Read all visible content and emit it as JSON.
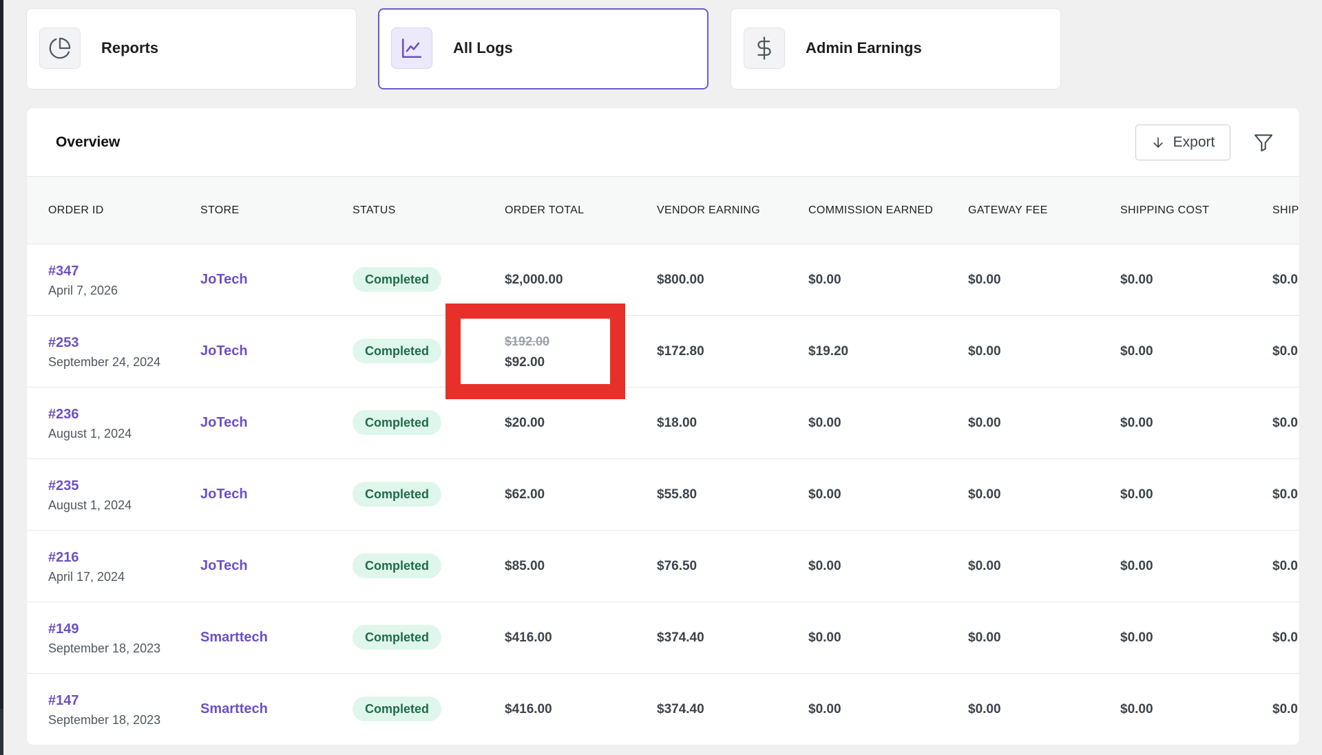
{
  "tabs": [
    {
      "label": "Reports",
      "icon": "pie-chart-icon"
    },
    {
      "label": "All Logs",
      "icon": "line-chart-icon"
    },
    {
      "label": "Admin Earnings",
      "icon": "dollar-icon"
    }
  ],
  "panel": {
    "title": "Overview",
    "export_label": "Export"
  },
  "columns": [
    "Order ID",
    "Store",
    "Status",
    "Order Total",
    "Vendor Earning",
    "Commission Earned",
    "Gateway Fee",
    "Shipping Cost",
    "Ship"
  ],
  "rows": [
    {
      "id": "#347",
      "date": "April 7, 2026",
      "store": "JoTech",
      "status": "Completed",
      "total": "$2,000.00",
      "total_old": "",
      "vendor": "$800.00",
      "commission": "$0.00",
      "gateway": "$0.00",
      "shipping": "$0.00",
      "ship2": "$0.0"
    },
    {
      "id": "#253",
      "date": "September 24, 2024",
      "store": "JoTech",
      "status": "Completed",
      "total": "$92.00",
      "total_old": "$192.00",
      "vendor": "$172.80",
      "commission": "$19.20",
      "gateway": "$0.00",
      "shipping": "$0.00",
      "ship2": "$0.0"
    },
    {
      "id": "#236",
      "date": "August 1, 2024",
      "store": "JoTech",
      "status": "Completed",
      "total": "$20.00",
      "total_old": "",
      "vendor": "$18.00",
      "commission": "$0.00",
      "gateway": "$0.00",
      "shipping": "$0.00",
      "ship2": "$0.0"
    },
    {
      "id": "#235",
      "date": "August 1, 2024",
      "store": "JoTech",
      "status": "Completed",
      "total": "$62.00",
      "total_old": "",
      "vendor": "$55.80",
      "commission": "$0.00",
      "gateway": "$0.00",
      "shipping": "$0.00",
      "ship2": "$0.0"
    },
    {
      "id": "#216",
      "date": "April 17, 2024",
      "store": "JoTech",
      "status": "Completed",
      "total": "$85.00",
      "total_old": "",
      "vendor": "$76.50",
      "commission": "$0.00",
      "gateway": "$0.00",
      "shipping": "$0.00",
      "ship2": "$0.0"
    },
    {
      "id": "#149",
      "date": "September 18, 2023",
      "store": "Smarttech",
      "status": "Completed",
      "total": "$416.00",
      "total_old": "",
      "vendor": "$374.40",
      "commission": "$0.00",
      "gateway": "$0.00",
      "shipping": "$0.00",
      "ship2": "$0.0"
    },
    {
      "id": "#147",
      "date": "September 18, 2023",
      "store": "Smarttech",
      "status": "Completed",
      "total": "$416.00",
      "total_old": "",
      "vendor": "$374.40",
      "commission": "$0.00",
      "gateway": "$0.00",
      "shipping": "$0.00",
      "ship2": "$0.0"
    }
  ],
  "colors": {
    "accent": "#6c4fc3",
    "active_border": "#6c5cc7",
    "badge_bg": "#dff6ec",
    "badge_text": "#1f6b4a",
    "highlight_box": "#e8302a"
  }
}
